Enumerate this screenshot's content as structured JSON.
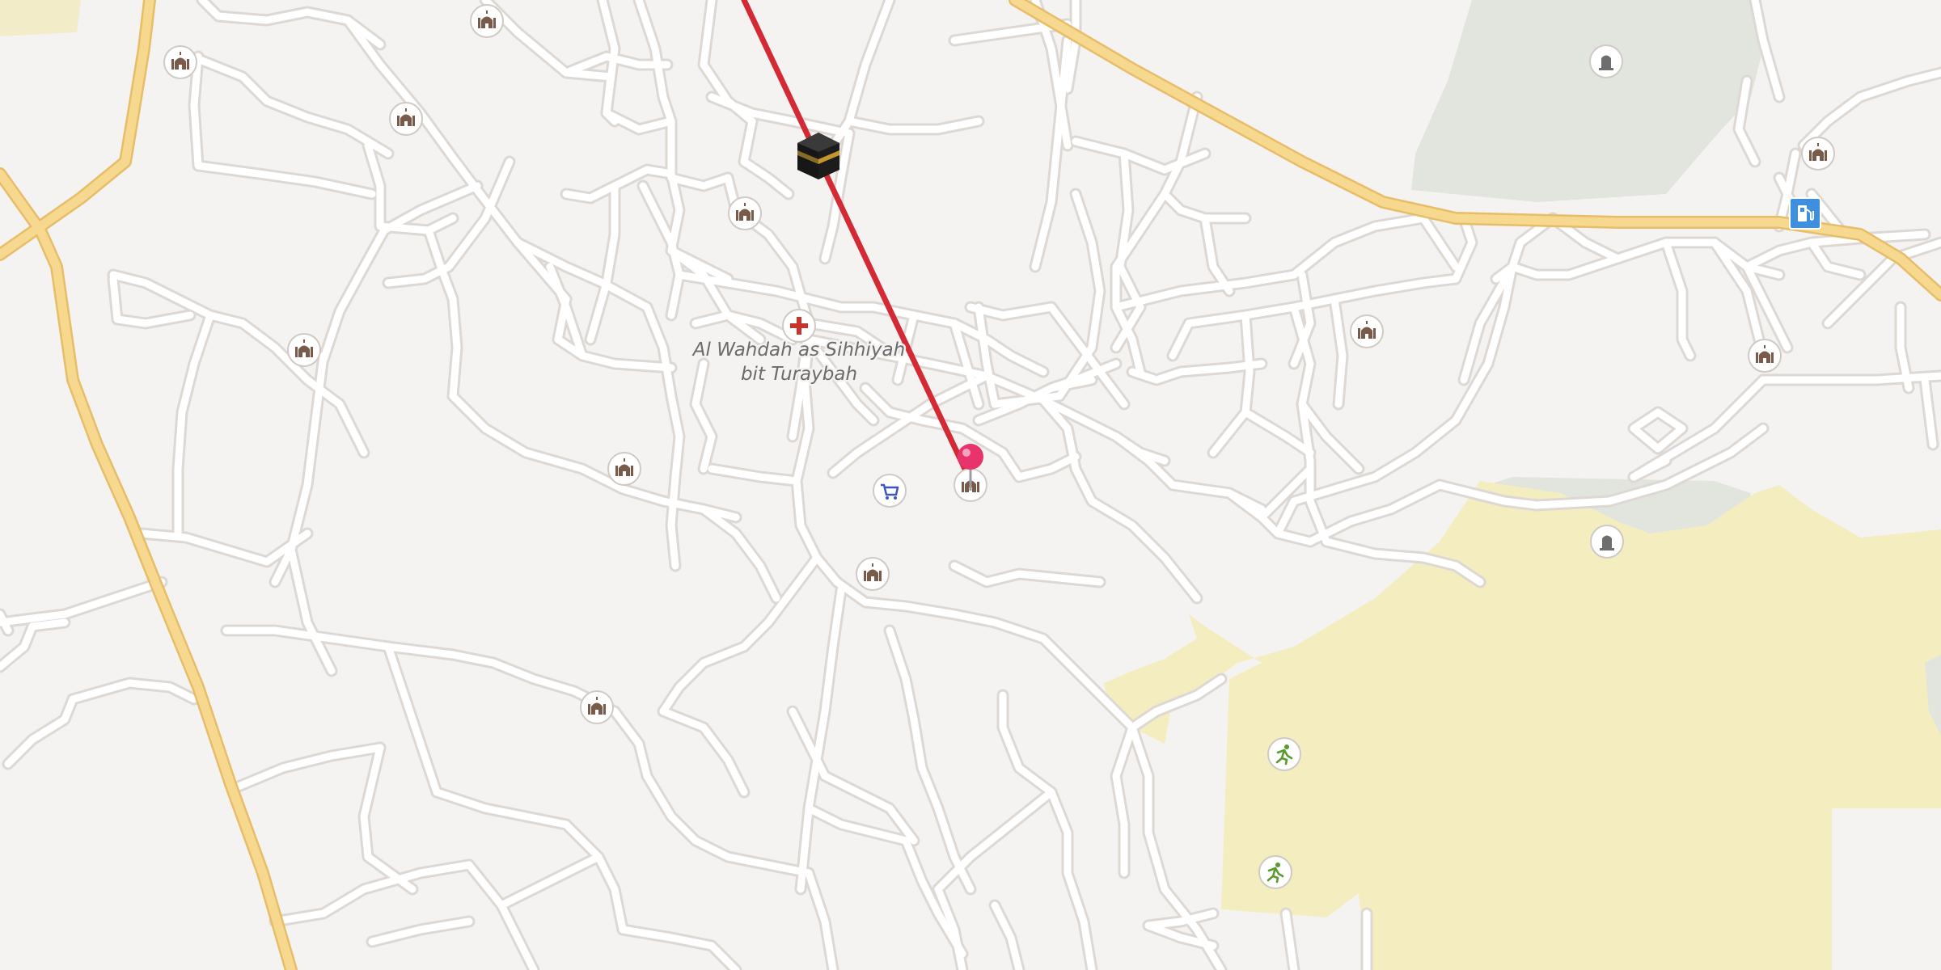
{
  "map": {
    "area_label_line1": "Al Wahdah as Sihhiyah",
    "area_label_line2": "bit Turaybah",
    "colors": {
      "background": "#f5f3f1",
      "road": "#ffffff",
      "road_casing": "#dcd7d2",
      "major_road": "#f6d88f",
      "major_road_casing": "#e7bd6a",
      "park": "#f3ecc0",
      "cemetery": "#e2e3dd",
      "route_line": "#d42a34",
      "pin": "#e8336d"
    },
    "icons": {
      "mosque": "mosque-icon",
      "cemetery": "cemetery-icon",
      "hospital": "hospital-cross-icon",
      "shop": "shopping-cart-icon",
      "sports": "running-person-icon",
      "fuel": "fuel-pump-icon",
      "kaaba": "kaaba-icon",
      "pin": "location-pin-icon"
    }
  }
}
